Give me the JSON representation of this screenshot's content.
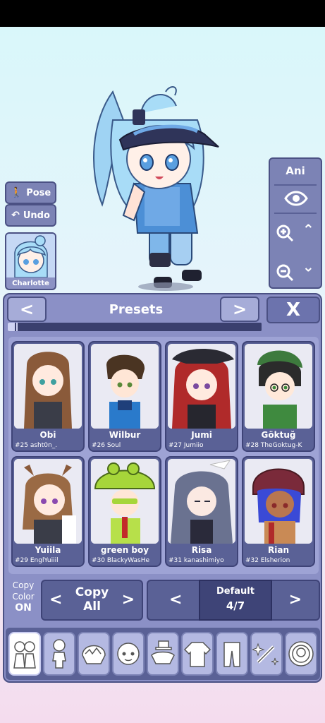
{
  "pose_controls": {
    "pose_label": "Pose",
    "undo_label": "Undo",
    "character_name": "Charlotte"
  },
  "view_controls": {
    "ani_label": "Ani"
  },
  "presets": {
    "title": "Presets",
    "prev_label": "<",
    "next_label": ">",
    "close_label": "X",
    "progress_fraction": 0.04,
    "items": [
      {
        "name": "Obi",
        "id": "#25 asht0n_."
      },
      {
        "name": "Wilbur",
        "id": "#26 Soul"
      },
      {
        "name": "Jumi",
        "id": "#27 Jumiio"
      },
      {
        "name": "Göktuğ",
        "id": "#28 TheGoktug-K"
      },
      {
        "name": "Yuiila",
        "id": "#29 EnglYuiiil"
      },
      {
        "name": "green boy",
        "id": "#30 BlackyWasHe"
      },
      {
        "name": "Risa",
        "id": "#31 kanashimiyo"
      },
      {
        "name": "Rian",
        "id": "#32 Elsherion"
      }
    ]
  },
  "copy_controls": {
    "copy_color_line1": "Copy",
    "copy_color_line2": "Color",
    "copy_color_state": "ON",
    "copy_line1": "Copy",
    "copy_line2": "All",
    "left_arrow": "<",
    "right_arrow": ">"
  },
  "slot_selector": {
    "label": "Default",
    "count": "4/7",
    "left_arrow": "<",
    "right_arrow": ">"
  },
  "bottom_tabs": [
    {
      "icon": "presets-icon",
      "active": true
    },
    {
      "icon": "body-icon"
    },
    {
      "icon": "hair-icon"
    },
    {
      "icon": "face-icon"
    },
    {
      "icon": "accessory-icon"
    },
    {
      "icon": "top-clothing-icon"
    },
    {
      "icon": "bottom-clothing-icon"
    },
    {
      "icon": "effects-icon"
    },
    {
      "icon": "profile-icon"
    }
  ],
  "colors": {
    "panel": "#8b90c6",
    "panel_border": "#4b5184",
    "button_dark": "#5a6196"
  }
}
